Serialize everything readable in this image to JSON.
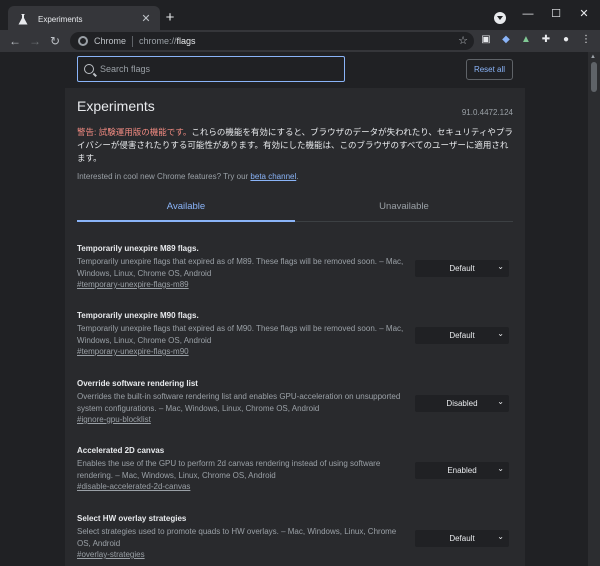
{
  "window": {
    "tab_title": "Experiments",
    "minimize": "—",
    "maximize": "☐",
    "close": "✕"
  },
  "toolbar": {
    "omnibox_chrome": "Chrome",
    "omnibox_scheme": "chrome://",
    "omnibox_path": "flags"
  },
  "header": {
    "search_placeholder": "Search flags",
    "reset_label": "Reset all"
  },
  "page": {
    "title": "Experiments",
    "version": "91.0.4472.124",
    "warning_prefix": "警告: 試験運用版の機能です。",
    "warning_body": "これらの機能を有効にすると、ブラウザのデータが失われたり、セキュリティやプライバシーが侵害されたりする可能性があります。有効にした機能は、このブラウザのすべてのユーザーに適用されます。",
    "interest_text": "Interested in cool new Chrome features? Try our ",
    "interest_link": "beta channel",
    "interest_end": ".",
    "tab_available": "Available",
    "tab_unavailable": "Unavailable"
  },
  "experiments": [
    {
      "name": "Temporarily unexpire M89 flags.",
      "desc": "Temporarily unexpire flags that expired as of M89. These flags will be removed soon. – Mac, Windows, Linux, Chrome OS, Android",
      "link": "#temporary-unexpire-flags-m89",
      "value": "Default"
    },
    {
      "name": "Temporarily unexpire M90 flags.",
      "desc": "Temporarily unexpire flags that expired as of M90. These flags will be removed soon. – Mac, Windows, Linux, Chrome OS, Android",
      "link": "#temporary-unexpire-flags-m90",
      "value": "Default"
    },
    {
      "name": "Override software rendering list",
      "desc": "Overrides the built-in software rendering list and enables GPU-acceleration on unsupported system configurations. – Mac, Windows, Linux, Chrome OS, Android",
      "link": "#ignore-gpu-blocklist",
      "value": "Disabled"
    },
    {
      "name": "Accelerated 2D canvas",
      "desc": "Enables the use of the GPU to perform 2d canvas rendering instead of using software rendering. – Mac, Windows, Linux, Chrome OS, Android",
      "link": "#disable-accelerated-2d-canvas",
      "value": "Enabled"
    },
    {
      "name": "Select HW overlay strategies",
      "desc": "Select strategies used to promote quads to HW overlays. – Mac, Windows, Linux, Chrome OS, Android",
      "link": "#overlay-strategies",
      "value": "Default"
    }
  ]
}
